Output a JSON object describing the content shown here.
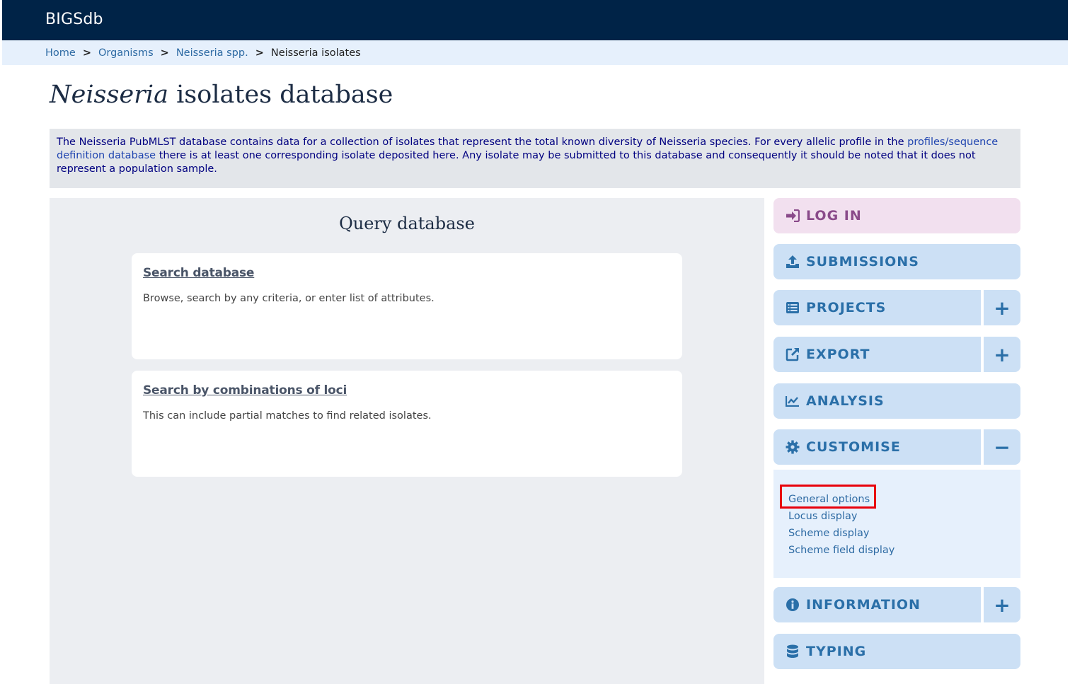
{
  "header": {
    "brand": "BIGSdb"
  },
  "breadcrumb": {
    "items": [
      "Home",
      "Organisms",
      "Neisseria spp."
    ],
    "separator": ">",
    "current": "Neisseria isolates"
  },
  "title": {
    "italic": "Neisseria",
    "rest": " isolates database"
  },
  "intro": {
    "text_before": "The Neisseria PubMLST database contains data for a collection of isolates that represent the total known diversity of Neisseria species. For every allelic profile in the ",
    "link": "profiles/sequence definition database",
    "text_after": " there is at least one corresponding isolate deposited here. Any isolate may be submitted to this database and consequently it should be noted that it does not represent a population sample."
  },
  "query": {
    "title": "Query database",
    "cards": [
      {
        "link": "Search database",
        "desc": "Browse, search by any criteria, or enter list of attributes."
      },
      {
        "link": "Search by combinations of loci",
        "desc": "This can include partial matches to find related isolates."
      }
    ]
  },
  "sidebar": {
    "login": "LOG IN",
    "submissions": "SUBMISSIONS",
    "projects": "PROJECTS",
    "export": "EXPORT",
    "analysis": "ANALYSIS",
    "customise": "CUSTOMISE",
    "information": "INFORMATION",
    "typing": "TYPING",
    "plus": "+",
    "minus": "−",
    "customise_items": [
      "General options",
      "Locus display",
      "Scheme display",
      "Scheme field display"
    ]
  },
  "colors": {
    "header_bg": "#002347",
    "button_bg": "#cce0f5",
    "login_bg": "#f2e0ef",
    "highlight": "#e8000b"
  },
  "icons": [
    "sign-in-icon",
    "upload-icon",
    "list-icon",
    "external-link-icon",
    "chart-line-icon",
    "cog-icon",
    "info-circle-icon",
    "database-icon"
  ]
}
